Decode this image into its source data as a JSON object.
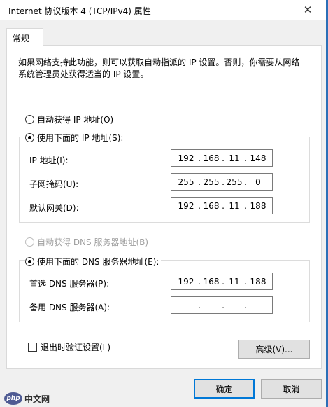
{
  "window": {
    "title": "Internet 协议版本 4 (TCP/IPv4) 属性",
    "close_glyph": "✕"
  },
  "tab": {
    "label": "常规"
  },
  "description": "如果网络支持此功能，则可以获取自动指派的 IP 设置。否则，你需要从网络系统管理员处获得适当的 IP 设置。",
  "ip": {
    "auto_label": "自动获得 IP 地址(O)",
    "manual_label": "使用下面的 IP 地址(S):",
    "selected": "manual",
    "address": {
      "label": "IP 地址(I):",
      "octets": [
        "192",
        "168",
        "11",
        "148"
      ]
    },
    "subnet": {
      "label": "子网掩码(U):",
      "octets": [
        "255",
        "255",
        "255",
        "0"
      ]
    },
    "gateway": {
      "label": "默认网关(D):",
      "octets": [
        "192",
        "168",
        "11",
        "188"
      ]
    }
  },
  "dns": {
    "auto_label": "自动获得 DNS 服务器地址(B)",
    "manual_label": "使用下面的 DNS 服务器地址(E):",
    "selected": "manual",
    "preferred": {
      "label": "首选 DNS 服务器(P):",
      "octets": [
        "192",
        "168",
        "11",
        "188"
      ]
    },
    "alternate": {
      "label": "备用 DNS 服务器(A):",
      "octets": [
        "",
        "",
        "",
        ""
      ]
    }
  },
  "validate": {
    "label": "退出时验证设置(L)",
    "checked": false
  },
  "buttons": {
    "advanced": "高级(V)...",
    "ok": "确定",
    "cancel": "取消"
  },
  "watermark": {
    "logo": "php",
    "text": "中文网"
  },
  "colors": {
    "accent": "#0078d7",
    "window_border": "#2b6fb7"
  }
}
